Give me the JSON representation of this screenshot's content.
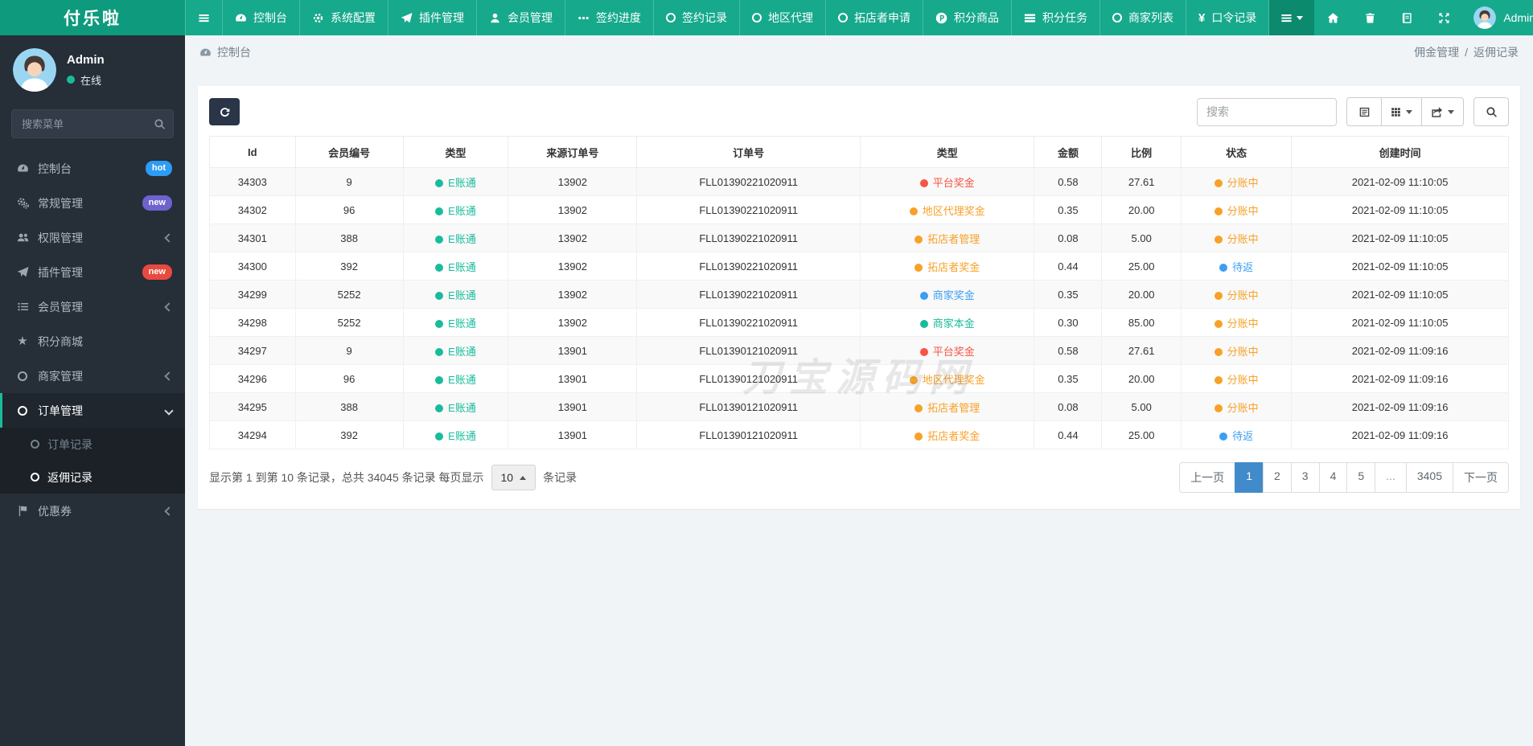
{
  "app": {
    "title": "付乐啦"
  },
  "icons": {
    "yen": "¥",
    "star": "★"
  },
  "topnav": {
    "items": [
      "控制台",
      "系统配置",
      "插件管理",
      "会员管理",
      "签约进度",
      "签约记录",
      "地区代理",
      "拓店者申请",
      "积分商品",
      "积分任务",
      "商家列表",
      "口令记录"
    ],
    "user": "Admin"
  },
  "sidebar": {
    "user": {
      "name": "Admin",
      "status": "在线"
    },
    "search_placeholder": "搜索菜单",
    "items": [
      {
        "label": "控制台",
        "badge": "hot"
      },
      {
        "label": "常规管理",
        "badge": "new"
      },
      {
        "label": "权限管理"
      },
      {
        "label": "插件管理",
        "badge": "new"
      },
      {
        "label": "会员管理"
      },
      {
        "label": "积分商城"
      },
      {
        "label": "商家管理"
      },
      {
        "label": "订单管理",
        "children": [
          {
            "label": "订单记录"
          },
          {
            "label": "返佣记录"
          }
        ]
      },
      {
        "label": "优惠券"
      }
    ]
  },
  "breadcrumb": {
    "page": "控制台",
    "parent": "佣金管理",
    "separator": "/",
    "current": "返佣记录"
  },
  "toolbar": {
    "search_placeholder": "搜索"
  },
  "table": {
    "columns": [
      "Id",
      "会员编号",
      "类型",
      "来源订单号",
      "订单号",
      "类型",
      "金额",
      "比例",
      "状态",
      "创建时间"
    ],
    "rows": [
      {
        "id": "34303",
        "member": "9",
        "account_type": "E账通",
        "source": "13902",
        "order": "FLL01390221020911",
        "bonus": "平台奖金",
        "bonus_color": "red",
        "amount": "0.58",
        "ratio": "27.61",
        "status": "分账中",
        "status_color": "orange",
        "created": "2021-02-09 11:10:05"
      },
      {
        "id": "34302",
        "member": "96",
        "account_type": "E账通",
        "source": "13902",
        "order": "FLL01390221020911",
        "bonus": "地区代理奖金",
        "bonus_color": "orange",
        "amount": "0.35",
        "ratio": "20.00",
        "status": "分账中",
        "status_color": "orange",
        "created": "2021-02-09 11:10:05"
      },
      {
        "id": "34301",
        "member": "388",
        "account_type": "E账通",
        "source": "13902",
        "order": "FLL01390221020911",
        "bonus": "拓店者管理",
        "bonus_color": "orange",
        "amount": "0.08",
        "ratio": "5.00",
        "status": "分账中",
        "status_color": "orange",
        "created": "2021-02-09 11:10:05"
      },
      {
        "id": "34300",
        "member": "392",
        "account_type": "E账通",
        "source": "13902",
        "order": "FLL01390221020911",
        "bonus": "拓店者奖金",
        "bonus_color": "orange",
        "amount": "0.44",
        "ratio": "25.00",
        "status": "待返",
        "status_color": "blue",
        "created": "2021-02-09 11:10:05"
      },
      {
        "id": "34299",
        "member": "5252",
        "account_type": "E账通",
        "source": "13902",
        "order": "FLL01390221020911",
        "bonus": "商家奖金",
        "bonus_color": "blue",
        "amount": "0.35",
        "ratio": "20.00",
        "status": "分账中",
        "status_color": "orange",
        "created": "2021-02-09 11:10:05"
      },
      {
        "id": "34298",
        "member": "5252",
        "account_type": "E账通",
        "source": "13902",
        "order": "FLL01390221020911",
        "bonus": "商家本金",
        "bonus_color": "green",
        "amount": "0.30",
        "ratio": "85.00",
        "status": "分账中",
        "status_color": "orange",
        "created": "2021-02-09 11:10:05"
      },
      {
        "id": "34297",
        "member": "9",
        "account_type": "E账通",
        "source": "13901",
        "order": "FLL01390121020911",
        "bonus": "平台奖金",
        "bonus_color": "red",
        "amount": "0.58",
        "ratio": "27.61",
        "status": "分账中",
        "status_color": "orange",
        "created": "2021-02-09 11:09:16"
      },
      {
        "id": "34296",
        "member": "96",
        "account_type": "E账通",
        "source": "13901",
        "order": "FLL01390121020911",
        "bonus": "地区代理奖金",
        "bonus_color": "orange",
        "amount": "0.35",
        "ratio": "20.00",
        "status": "分账中",
        "status_color": "orange",
        "created": "2021-02-09 11:09:16"
      },
      {
        "id": "34295",
        "member": "388",
        "account_type": "E账通",
        "source": "13901",
        "order": "FLL01390121020911",
        "bonus": "拓店者管理",
        "bonus_color": "orange",
        "amount": "0.08",
        "ratio": "5.00",
        "status": "分账中",
        "status_color": "orange",
        "created": "2021-02-09 11:09:16"
      },
      {
        "id": "34294",
        "member": "392",
        "account_type": "E账通",
        "source": "13901",
        "order": "FLL01390121020911",
        "bonus": "拓店者奖金",
        "bonus_color": "orange",
        "amount": "0.44",
        "ratio": "25.00",
        "status": "待返",
        "status_color": "blue",
        "created": "2021-02-09 11:09:16"
      }
    ]
  },
  "footer": {
    "summary_prefix": "显示第 1 到第 10 条记录，总共 34045 条记录 每页显示",
    "page_size": "10",
    "summary_suffix": "条记录",
    "pages": [
      "上一页",
      "1",
      "2",
      "3",
      "4",
      "5",
      "...",
      "3405",
      "下一页"
    ],
    "active_page": "1"
  },
  "watermark": "刀宝源码网",
  "colors": {
    "green": "#18bc9c",
    "red": "#f75444",
    "orange": "#f7a128",
    "blue": "#3d9df3",
    "teal": "#18bc9c"
  }
}
